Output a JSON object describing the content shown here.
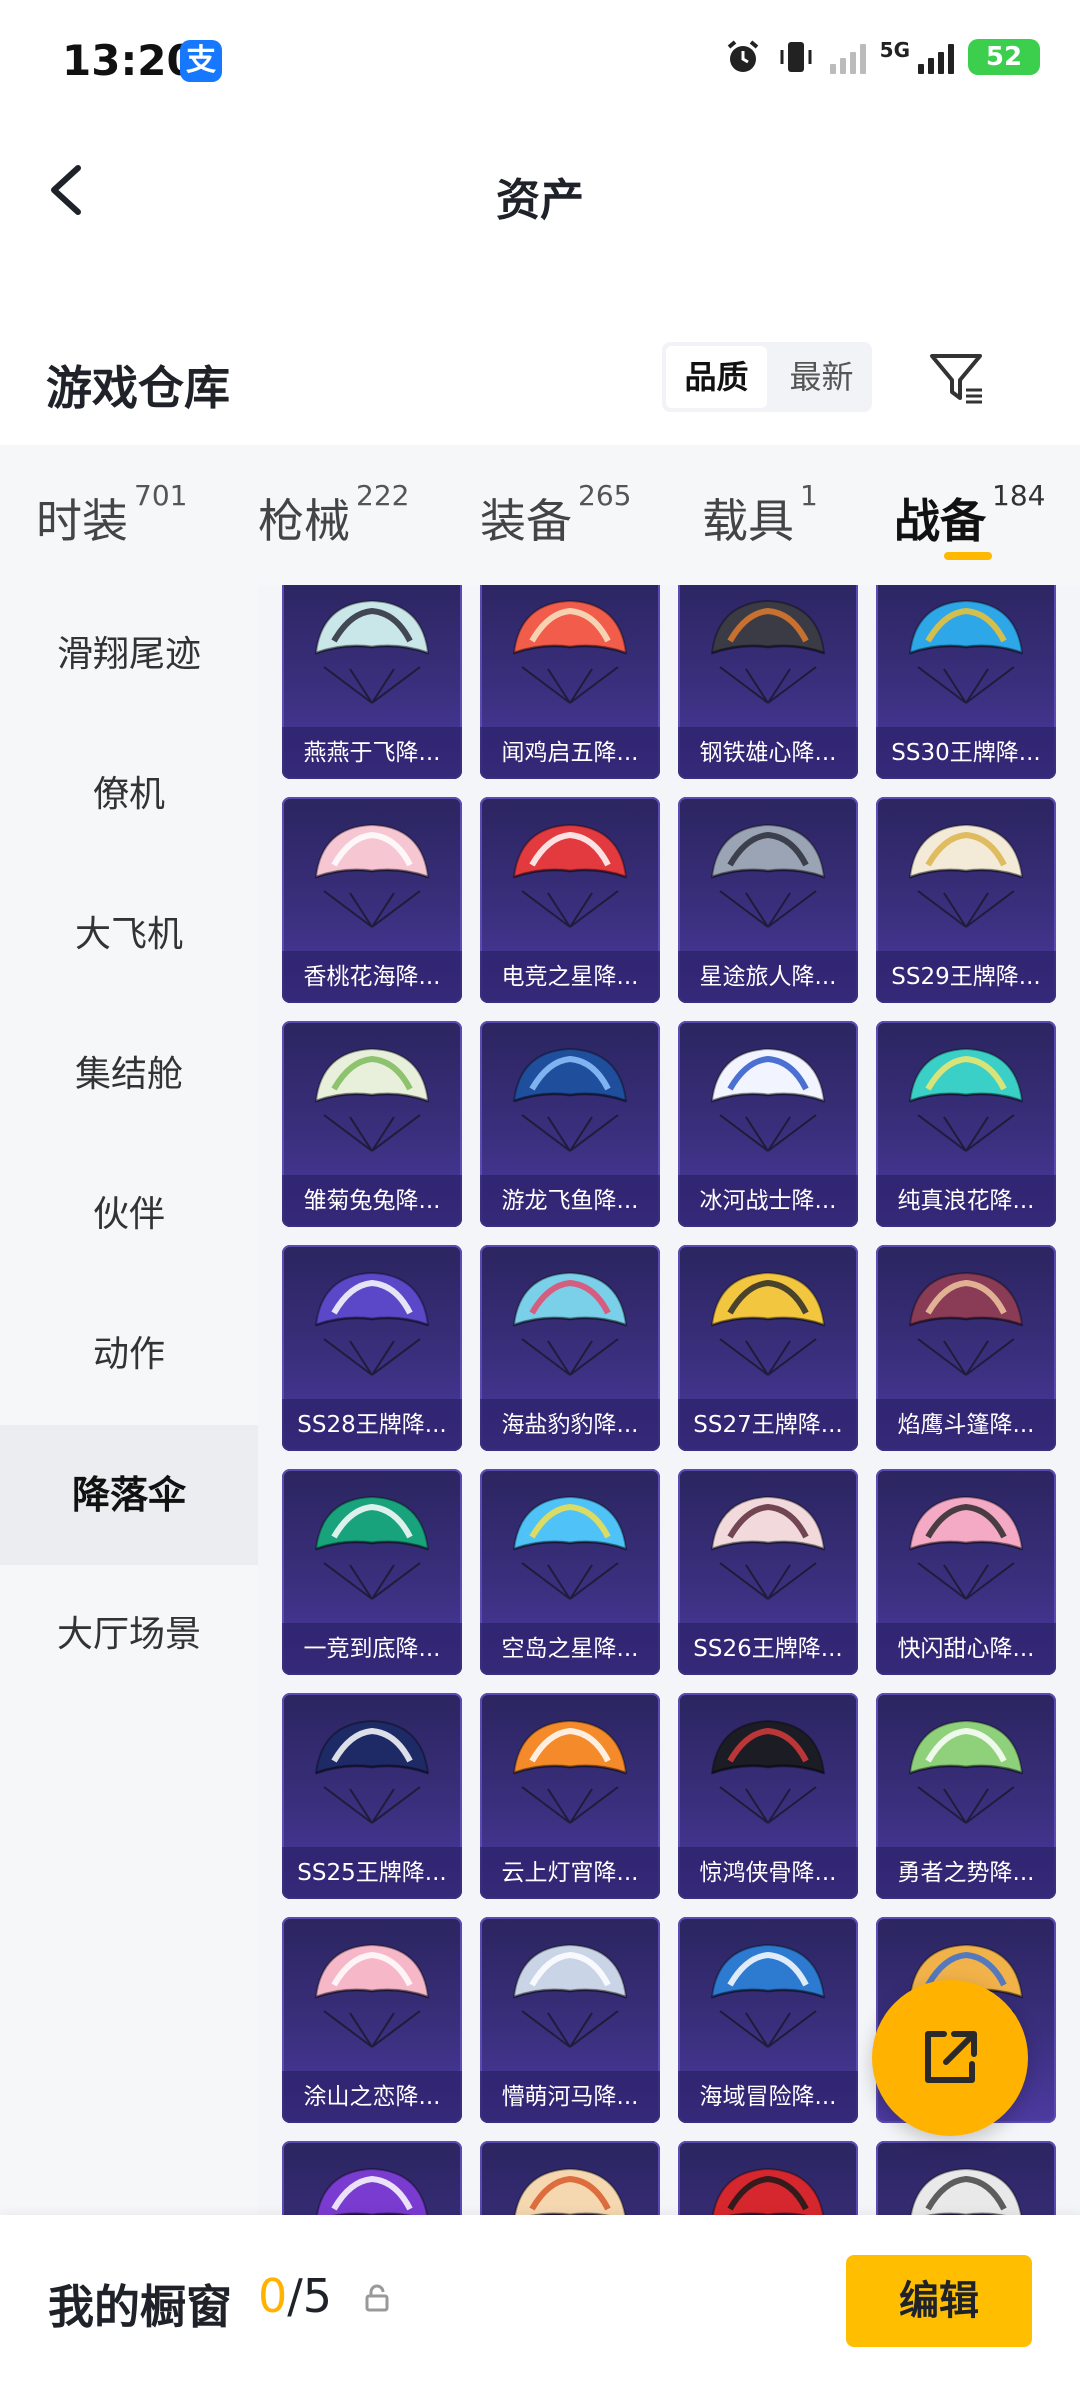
{
  "status_bar": {
    "time": "13:20",
    "alipay_glyph": "支",
    "network": "5G",
    "battery": "52"
  },
  "nav": {
    "title": "资产"
  },
  "warehouse": {
    "title": "游戏仓库",
    "sort_options": [
      "品质",
      "最新"
    ],
    "active_sort": "品质"
  },
  "category_tabs": [
    {
      "label": "时装",
      "count": "701"
    },
    {
      "label": "枪械",
      "count": "222"
    },
    {
      "label": "装备",
      "count": "265"
    },
    {
      "label": "载具",
      "count": "1"
    },
    {
      "label": "战备",
      "count": "184"
    }
  ],
  "active_tab": "战备",
  "sidebar": [
    "滑翔尾迹",
    "僚机",
    "大飞机",
    "集结舱",
    "伙伴",
    "动作",
    "降落伞",
    "大厅场景"
  ],
  "active_sidebar": "降落伞",
  "items": [
    "燕燕于飞降...",
    "闻鸡启五降...",
    "钢铁雄心降...",
    "SS30王牌降...",
    "香桃花海降...",
    "电竞之星降...",
    "星途旅人降...",
    "SS29王牌降...",
    "雏菊兔兔降...",
    "游龙飞鱼降...",
    "冰河战士降...",
    "纯真浪花降...",
    "SS28王牌降...",
    "海盐豹豹降...",
    "SS27王牌降...",
    "焰鹰斗篷降...",
    "一竞到底降...",
    "空岛之星降...",
    "SS26王牌降...",
    "快闪甜心降...",
    "SS25王牌降...",
    "云上灯宵降...",
    "惊鸿侠骨降...",
    "勇者之势降...",
    "涂山之恋降...",
    "懵萌河马降...",
    "海域冒险降...",
    "",
    "",
    "",
    "",
    ""
  ],
  "chute_colors": [
    [
      "#c9e6e8",
      "#2a2a3a"
    ],
    [
      "#f25c4b",
      "#f7e6c4"
    ],
    [
      "#3b3b46",
      "#e07a2c"
    ],
    [
      "#2ea7e8",
      "#f1c232"
    ],
    [
      "#f7c6d3",
      "#ffffff"
    ],
    [
      "#e23a3f",
      "#ffffff"
    ],
    [
      "#9aa4b5",
      "#2b2f3a"
    ],
    [
      "#f3ead8",
      "#d9b44a"
    ],
    [
      "#e8f0dc",
      "#7dbb5a"
    ],
    [
      "#1f4f9c",
      "#8fc3ff"
    ],
    [
      "#f2f5ff",
      "#2d58c9"
    ],
    [
      "#3ad0c7",
      "#f5e66b"
    ],
    [
      "#5a48c9",
      "#ffffff"
    ],
    [
      "#7ad0e8",
      "#e5496d"
    ],
    [
      "#f3c63f",
      "#2a2a2a"
    ],
    [
      "#8a3b55",
      "#f0c7a0"
    ],
    [
      "#18a37c",
      "#ffffff"
    ],
    [
      "#4fc3f7",
      "#f5e04a"
    ],
    [
      "#f1d9dc",
      "#5a2a3a"
    ],
    [
      "#f4a9c4",
      "#2a2a2a"
    ],
    [
      "#1e2a66",
      "#ffffff"
    ],
    [
      "#f58a2a",
      "#ffffff"
    ],
    [
      "#1c1c24",
      "#d63b3b"
    ],
    [
      "#8ed17a",
      "#ffffff"
    ],
    [
      "#f6b7c8",
      "#ffffff"
    ],
    [
      "#c9d5e6",
      "#ffffff"
    ],
    [
      "#2d7bd1",
      "#ffffff"
    ],
    [
      "#f2b24a",
      "#3b6fd1"
    ],
    [
      "#7a3bd1",
      "#ffffff"
    ],
    [
      "#f5d7b0",
      "#d85a2a"
    ],
    [
      "#d6272e",
      "#1a1a1a"
    ],
    [
      "#e9e9e9",
      "#444444"
    ]
  ],
  "colors": {
    "accent": "#ffb800",
    "card_bg": "#3a2f7d",
    "edit_button": "#ffbf00"
  },
  "bottom": {
    "shop_label": "我的橱窗",
    "current": "0",
    "total": "/5",
    "edit_label": "编辑"
  },
  "icons": {
    "back": "chevron-left-icon",
    "filter": "filter-icon",
    "share": "share-external-icon",
    "lock": "lock-icon"
  }
}
